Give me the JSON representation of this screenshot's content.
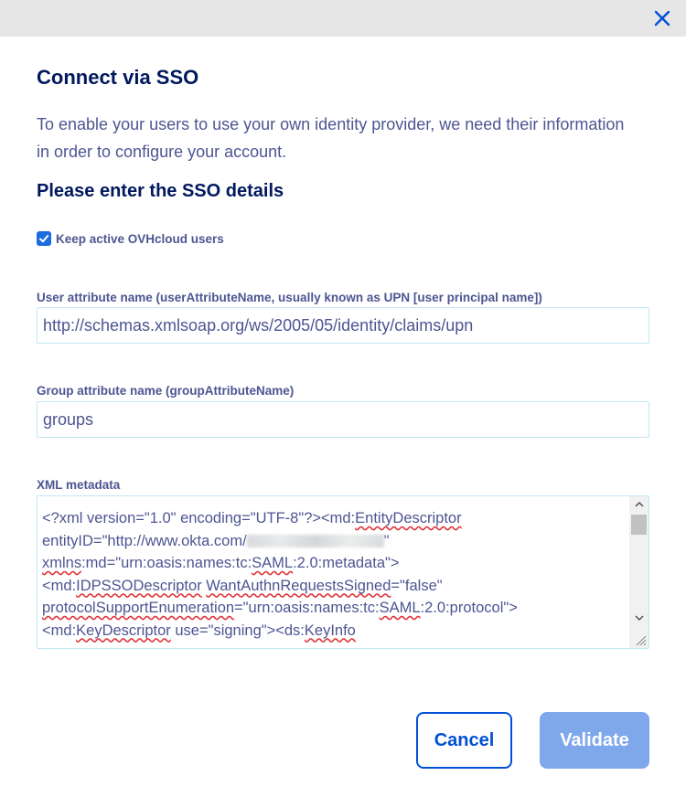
{
  "dialog": {
    "title": "Connect via SSO",
    "description": "To enable your users to use your own identity provider, we need their information in order to configure your account.",
    "subtitle": "Please enter the SSO details",
    "close_icon": "close-icon"
  },
  "form": {
    "keep_active": {
      "label": "Keep active OVHcloud users",
      "checked": true
    },
    "user_attribute": {
      "label": "User attribute name (userAttributeName, usually known as UPN [user principal name])",
      "value": "http://schemas.xmlsoap.org/ws/2005/05/identity/claims/upn"
    },
    "group_attribute": {
      "label": "Group attribute name (groupAttributeName)",
      "value": "groups"
    },
    "xml_metadata": {
      "label": "XML metadata",
      "lines": [
        "<?xml version=\"1.0\" encoding=\"UTF-8\"?><md:EntityDescriptor",
        "entityID=\"http://www.okta.com/",
        "\"",
        "xmlns:md=\"urn:oasis:names:tc:SAML:2.0:metadata\">",
        "<md:IDPSSODescriptor WantAuthnRequestsSigned=\"false\"",
        "protocolSupportEnumeration=\"urn:oasis:names:tc:SAML:2.0:protocol\">",
        "<md:KeyDescriptor use=\"signing\"><ds:KeyInfo"
      ]
    }
  },
  "buttons": {
    "cancel": "Cancel",
    "validate": "Validate"
  },
  "colors": {
    "primary": "#0050d7",
    "heading": "#00185e",
    "text": "#4d5592",
    "validate_disabled": "#7fa8ec",
    "input_border": "#bfe7f5"
  }
}
